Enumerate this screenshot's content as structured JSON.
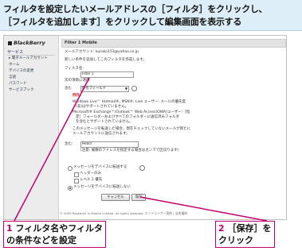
{
  "header": {
    "line1": "フィルタを設定したいメールアドレスの［フィルタ］をクリックし、",
    "line2": "［フィルタを追加します］をクリックして編集画面を表示する"
  },
  "sidebar": {
    "logo": "BlackBerry",
    "heading": "サービス",
    "items": [
      "▸ 電子メールアカウント",
      "ホーム",
      "デバイスの変更",
      "言語",
      "パスワード",
      "サービスブック"
    ]
  },
  "form": {
    "title": "Filter 1 Mobile",
    "email_label": "メールアカウント: kuroko153@yahoo.co.jp",
    "description": "新しい条件を追加してこのフィルタを作成します。",
    "filter_name_label": "フィルタ名:",
    "filter_name_value": "Filter 1",
    "field_label": "次の項目に適用:",
    "field_value": "件名フィールド",
    "help_icon": "?",
    "condition_label": "含む",
    "note_heading": "例外:",
    "bullets": [
      "Windows Live™ Hotmail®, MSN®, Live ユーザー: メールの優先度",
      "(高)はサポートされていません。",
      "Microsoft® Exchange™/Outlook™ Web Access(OWA)ユーザー:［指",
      "定］フォールダーおよびすべてのフォルダーに送信済みフォルダ",
      "を含むとサポートされていません。"
    ],
    "extra_note_1": "このメッセージを転送した場合、現在チェックしていないメールが新たに",
    "extra_note_2": "メールアカウントに送信されます。",
    "match_label": "含む:",
    "match_value": "Hello!",
    "match_hint": "(注意: 複数のアドレスを指定する場合はカンマで区切ります)",
    "radio1": "メッセージをデバイスに転送する",
    "check1": "ヘッダーのみ",
    "check2": "レベル 1 優先",
    "radio2": "メッセージをデバイスに転送しない",
    "cancel_label": "キャンセル",
    "save_label": "保存",
    "footer": "© 2009 Research In Motion Limited. All rights reserved. エンドユーザー契約 | 法的通知"
  },
  "callouts": {
    "left_num": "1",
    "left_text_1": "フィルタ名やフィルタ",
    "left_text_2": "の条件などを設定",
    "right_num": "2",
    "right_text_1": "［保存］を",
    "right_text_2": "クリック"
  }
}
